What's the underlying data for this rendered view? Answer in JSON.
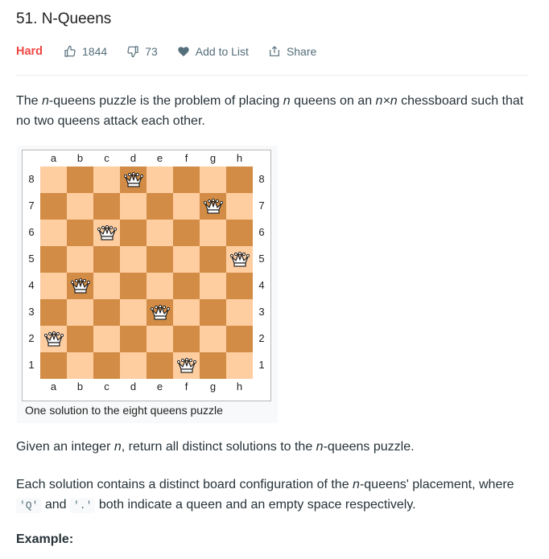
{
  "problem": {
    "title": "51. N-Queens"
  },
  "meta": {
    "difficulty": "Hard",
    "likes": "1844",
    "dislikes": "73",
    "add_to_list": "Add to List",
    "share": "Share"
  },
  "description": {
    "p1": [
      "The ",
      "n",
      "-queens puzzle is the problem of placing ",
      "n",
      " queens on an ",
      "n×n",
      " chessboard such that no two queens attack each other."
    ],
    "p2": [
      "Given an integer ",
      "n",
      ", return all distinct solutions to the ",
      "n",
      "-queens puzzle."
    ],
    "p3": [
      "Each solution contains a distinct board configuration of the ",
      "n",
      "-queens' placement, where ",
      "'Q'",
      " and ",
      "'.'",
      " both indicate a queen and an empty space respectively."
    ],
    "example_label": "Example:"
  },
  "figure": {
    "caption": "One solution to the eight queens puzzle",
    "files": [
      "a",
      "b",
      "c",
      "d",
      "e",
      "f",
      "g",
      "h"
    ],
    "ranks": [
      "8",
      "7",
      "6",
      "5",
      "4",
      "3",
      "2",
      "1"
    ],
    "queens": [
      {
        "file": "d",
        "rank": "8"
      },
      {
        "file": "g",
        "rank": "7"
      },
      {
        "file": "c",
        "rank": "6"
      },
      {
        "file": "h",
        "rank": "5"
      },
      {
        "file": "b",
        "rank": "4"
      },
      {
        "file": "e",
        "rank": "3"
      },
      {
        "file": "a",
        "rank": "2"
      },
      {
        "file": "f",
        "rank": "1"
      }
    ],
    "colors": {
      "light": "#fecda0",
      "dark": "#d28c45"
    }
  },
  "colors": {
    "difficulty_hard": "#ef4743",
    "meta_text": "#546e7a"
  }
}
